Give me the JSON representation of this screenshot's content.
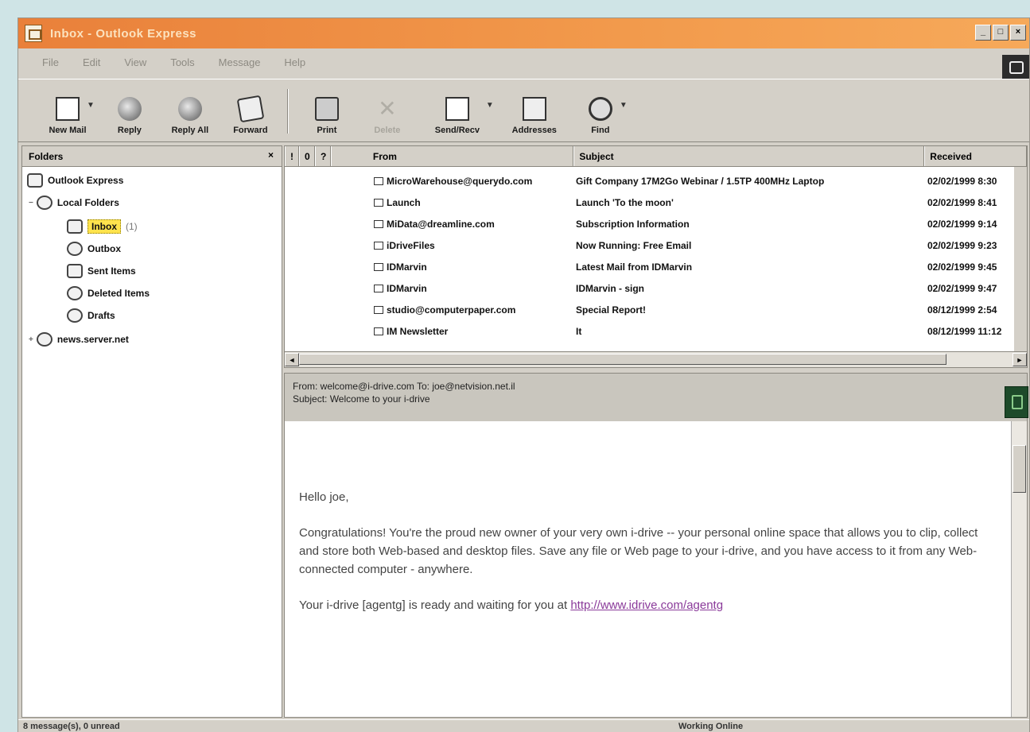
{
  "window": {
    "title": "Inbox - Outlook Express"
  },
  "menu": [
    "File",
    "Edit",
    "View",
    "Tools",
    "Message",
    "Help"
  ],
  "toolbar": [
    {
      "label": "New Mail",
      "icon": "new-mail-icon",
      "arrow": true
    },
    {
      "label": "Reply",
      "icon": "reply-icon"
    },
    {
      "label": "Reply All",
      "icon": "reply-all-icon"
    },
    {
      "label": "Forward",
      "icon": "forward-icon"
    },
    {
      "label": "Print",
      "icon": "print-icon"
    },
    {
      "label": "Delete",
      "icon": "delete-icon",
      "disabled": true
    },
    {
      "label": "Send/Recv",
      "icon": "send-receive-icon",
      "arrow": true
    },
    {
      "label": "Addresses",
      "icon": "address-book-icon"
    },
    {
      "label": "Find",
      "icon": "find-icon",
      "arrow": true
    }
  ],
  "folders": {
    "header": "Folders",
    "items": [
      {
        "label": "Outlook Express",
        "icon": "outlook-express-icon",
        "level": 0
      },
      {
        "label": "Local Folders",
        "icon": "local-folders-icon",
        "level": 1,
        "expand": "−"
      },
      {
        "label": "Inbox",
        "icon": "inbox-icon",
        "level": 2,
        "count": "(1)",
        "selected": true
      },
      {
        "label": "Outbox",
        "icon": "outbox-icon",
        "level": 2
      },
      {
        "label": "Sent Items",
        "icon": "sent-items-icon",
        "level": 2
      },
      {
        "label": "Deleted Items",
        "icon": "deleted-items-icon",
        "level": 2
      },
      {
        "label": "Drafts",
        "icon": "drafts-icon",
        "level": 2
      },
      {
        "label": "news.server.net",
        "icon": "news-server-icon",
        "level": 1,
        "expand": "+"
      }
    ]
  },
  "message_list": {
    "columns": {
      "priority": "!",
      "attach": "0",
      "flag": "?",
      "from": "From",
      "subject": "Subject",
      "received": "Received"
    },
    "rows": [
      {
        "from": "MicroWarehouse@querydo.com",
        "subject": "Gift Company 17M2Go Webinar / 1.5TP 400MHz Laptop",
        "date": "02/02/1999 8:30"
      },
      {
        "from": "Launch",
        "subject": "Launch 'To the moon'",
        "date": "02/02/1999 8:41"
      },
      {
        "from": "MiData@dreamline.com",
        "subject": "Subscription Information",
        "date": "02/02/1999 9:14"
      },
      {
        "from": "iDriveFiles",
        "subject": "Now Running: Free Email",
        "date": "02/02/1999 9:23"
      },
      {
        "from": "IDMarvin",
        "subject": "Latest Mail from IDMarvin",
        "date": "02/02/1999 9:45"
      },
      {
        "from": "IDMarvin",
        "subject": "IDMarvin - sign",
        "date": "02/02/1999 9:47"
      },
      {
        "from": "studio@computerpaper.com",
        "subject": "Special Report!",
        "date": "08/12/1999 2:54"
      },
      {
        "from": "IM Newsletter",
        "subject": "It",
        "date": "08/12/1999 11:12"
      }
    ]
  },
  "preview": {
    "from_line": "From: welcome@i-drive.com  To: joe@netvision.net.il",
    "subject_line": "Subject: Welcome to your i-drive",
    "greeting": "Hello joe,",
    "paragraph1": "Congratulations! You're the proud new owner of your very own i-drive -- your personal online space that allows you to clip, collect and store both Web-based and desktop files. Save any file or Web page to your i-drive, and you have access to it from any Web-connected computer - anywhere.",
    "paragraph2_text": "Your i-drive [agentg] is ready and waiting for you  at ",
    "paragraph2_link": "http://www.idrive.com/agentg"
  },
  "statusbar": {
    "left": "8 message(s), 0 unread",
    "right": "Working Online"
  },
  "colors": {
    "titlebar": "#e9803a",
    "selected_folder": "#ffe34d",
    "link": "#8a3a9a"
  }
}
